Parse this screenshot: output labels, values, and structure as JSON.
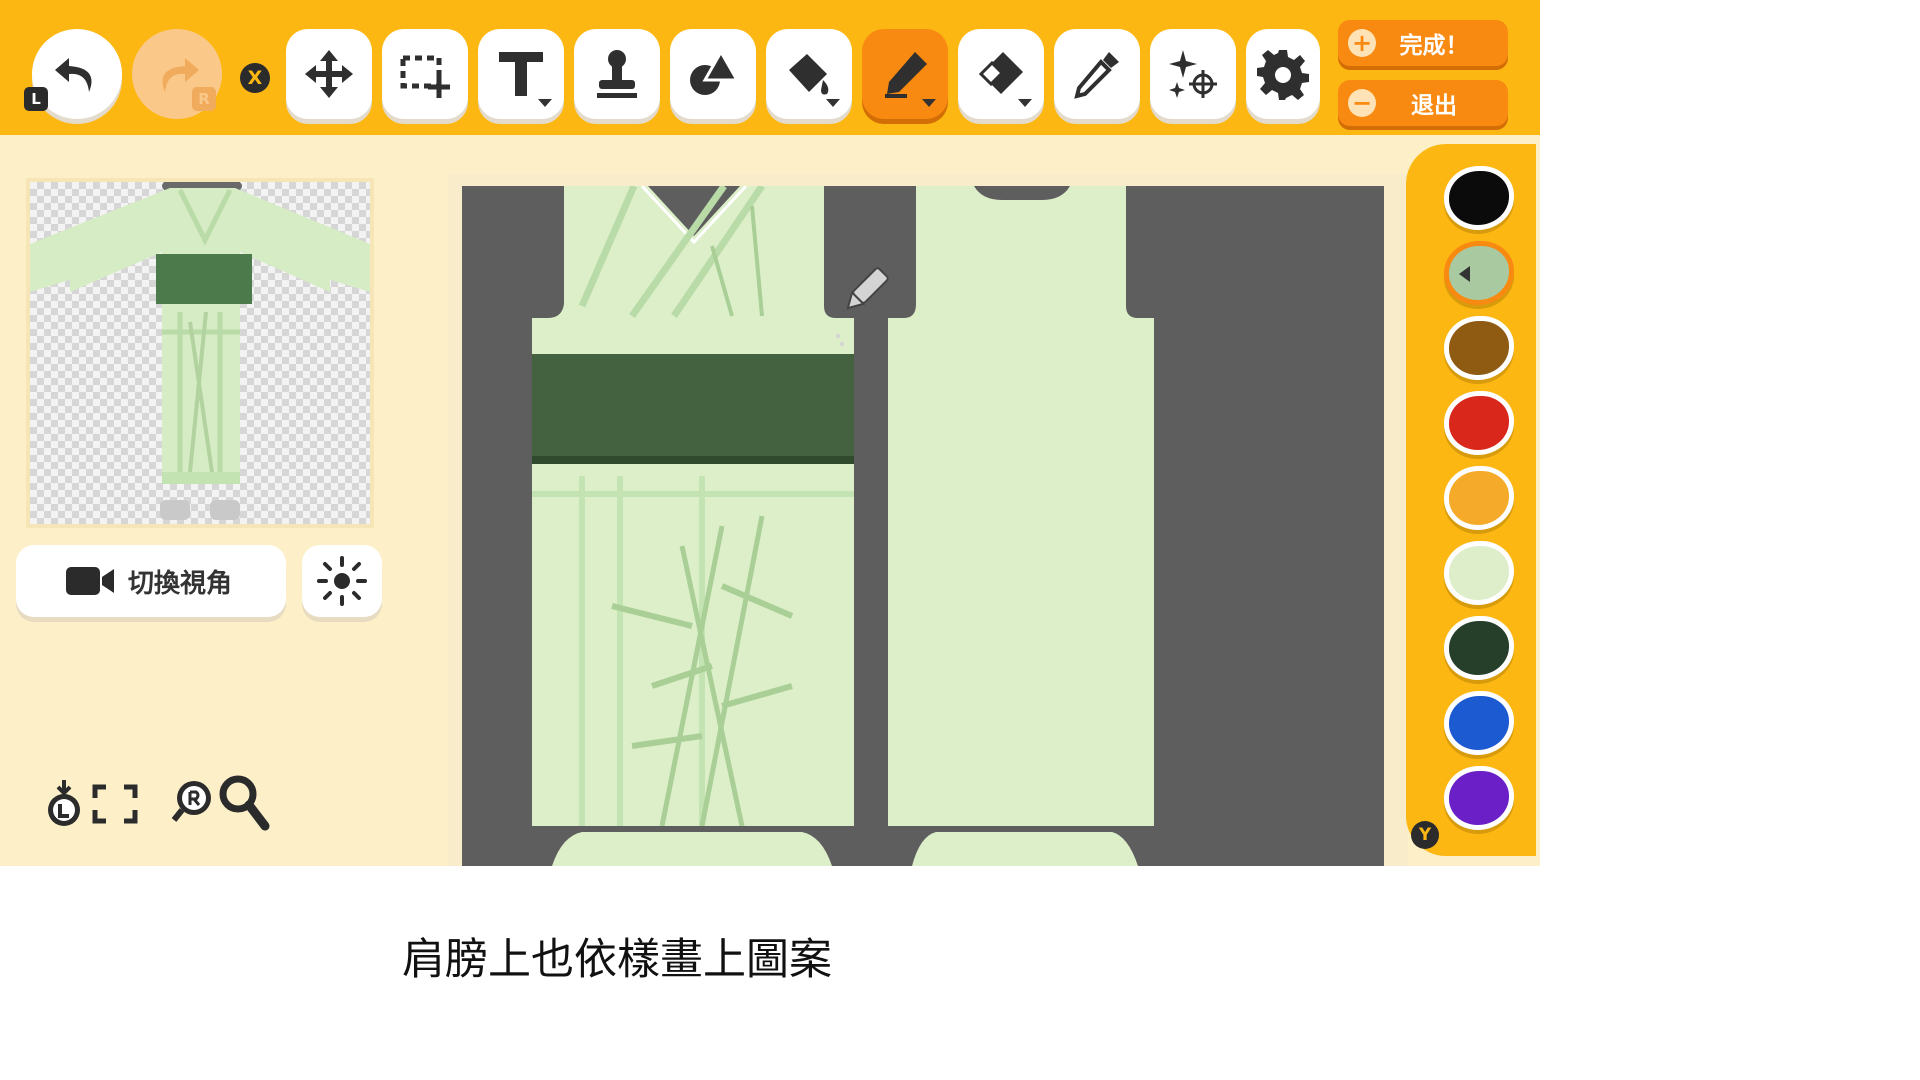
{
  "toolbar": {
    "tools": [
      {
        "name": "undo",
        "icon": "undo-arrow-icon",
        "key": "L"
      },
      {
        "name": "redo",
        "icon": "redo-arrow-icon",
        "key": "R",
        "enabled": false
      },
      {
        "name": "close",
        "icon": "x-button-icon",
        "key": "X"
      },
      {
        "name": "move",
        "icon": "move-cross-arrows-icon"
      },
      {
        "name": "select",
        "icon": "marquee-select-icon"
      },
      {
        "name": "text",
        "icon": "text-tool-icon"
      },
      {
        "name": "stamp",
        "icon": "stamp-icon"
      },
      {
        "name": "shapes",
        "icon": "shapes-icon"
      },
      {
        "name": "fill",
        "icon": "paint-bucket-icon"
      },
      {
        "name": "pen",
        "icon": "pen-icon",
        "active": true
      },
      {
        "name": "eraser",
        "icon": "eraser-icon"
      },
      {
        "name": "eyedropper",
        "icon": "eyedropper-icon"
      },
      {
        "name": "effects",
        "icon": "sparkle-target-icon"
      },
      {
        "name": "settings",
        "icon": "gear-icon"
      }
    ],
    "done_label": "完成！",
    "exit_label": "退出",
    "x_key": "X",
    "undo_key": "L",
    "redo_key": "R"
  },
  "left_panel": {
    "camera_label": "切換視角",
    "camera_icon": "video-camera-icon",
    "light_icon": "sun-icon",
    "bottom_icons": [
      "zoom-reset-l-icon",
      "fullscreen-icon",
      "zoom-r-icon",
      "magnifier-icon"
    ]
  },
  "palette": {
    "colors": [
      "#0b0b0b",
      "#a9c9a0",
      "#8f5a12",
      "#d9271b",
      "#f5aa2a",
      "#deeecb",
      "#263f2a",
      "#1c5ad1",
      "#6a1fc7"
    ],
    "selected_index": 1,
    "y_key": "Y"
  },
  "colors": {
    "toolbar": "#fdb713",
    "accent": "#f98a11",
    "background": "#fdf0c9",
    "canvas_gray": "#5e5e5e",
    "fabric": "#dcefc9",
    "sash": "#44623f"
  },
  "caption": "肩膀上也依樣畫上圖案"
}
